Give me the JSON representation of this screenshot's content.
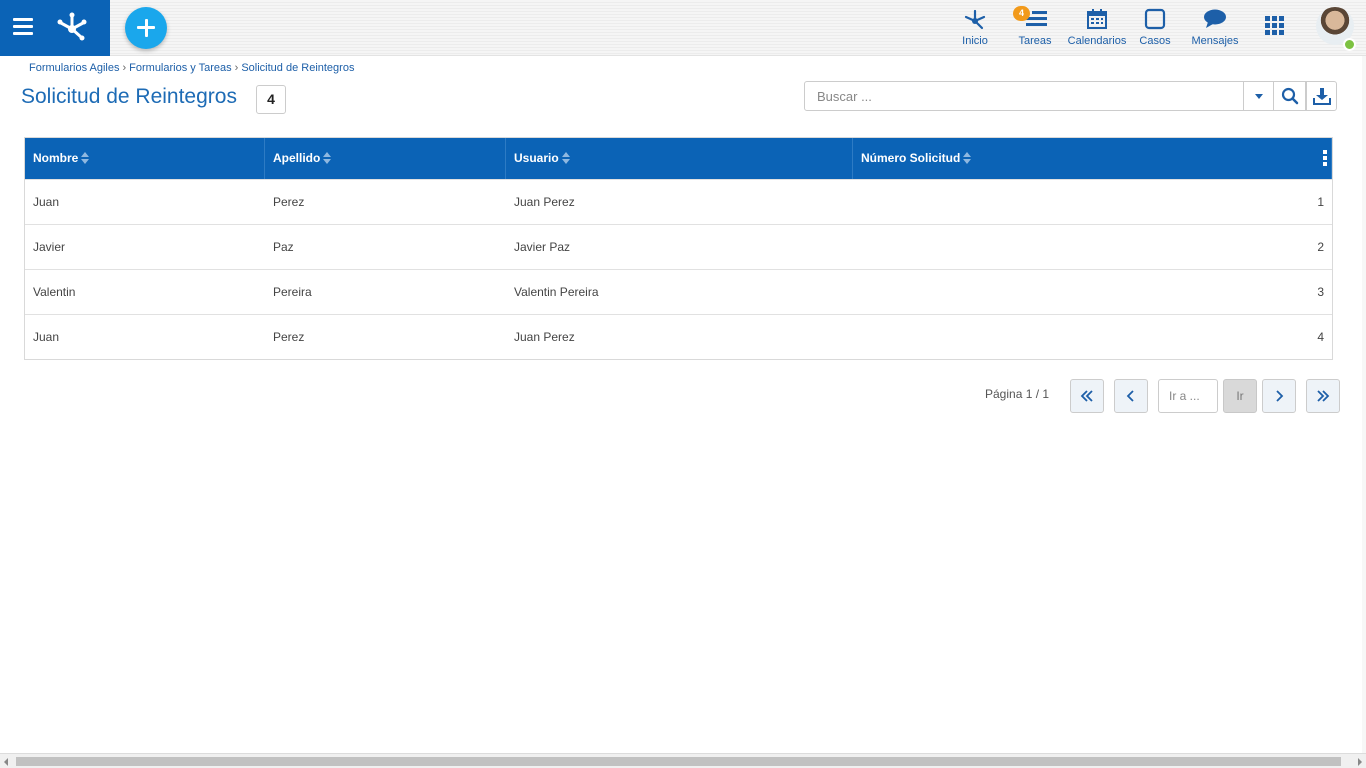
{
  "header": {
    "nav": [
      {
        "label": "Inicio",
        "icon": "home-network-icon"
      },
      {
        "label": "Tareas",
        "icon": "tasks-icon",
        "badge": "4"
      },
      {
        "label": "Calendarios",
        "icon": "calendar-icon"
      },
      {
        "label": "Casos",
        "icon": "cases-icon"
      },
      {
        "label": "Mensajes",
        "icon": "messages-icon"
      }
    ],
    "colors": {
      "brand": "#0b63b6",
      "add_button": "#1aa7ec",
      "badge": "#f29a1b",
      "online": "#7dc242"
    }
  },
  "breadcrumb": [
    "Formularios Agiles",
    "Formularios y Tareas",
    "Solicitud de Reintegros"
  ],
  "page": {
    "title": "Solicitud de Reintegros",
    "count": "4"
  },
  "search": {
    "placeholder": "Buscar ..."
  },
  "table": {
    "columns": [
      "Nombre",
      "Apellido",
      "Usuario",
      "Número Solicitud"
    ],
    "rows": [
      [
        "Juan",
        "Perez",
        "Juan Perez",
        "1"
      ],
      [
        "Javier",
        "Paz",
        "Javier Paz",
        "2"
      ],
      [
        "Valentin",
        "Pereira",
        "Valentin Pereira",
        "3"
      ],
      [
        "Juan",
        "Perez",
        "Juan Perez",
        "4"
      ]
    ]
  },
  "pagination": {
    "info": "Página 1 / 1",
    "goto_placeholder": "Ir a ...",
    "go_label": "Ir"
  }
}
